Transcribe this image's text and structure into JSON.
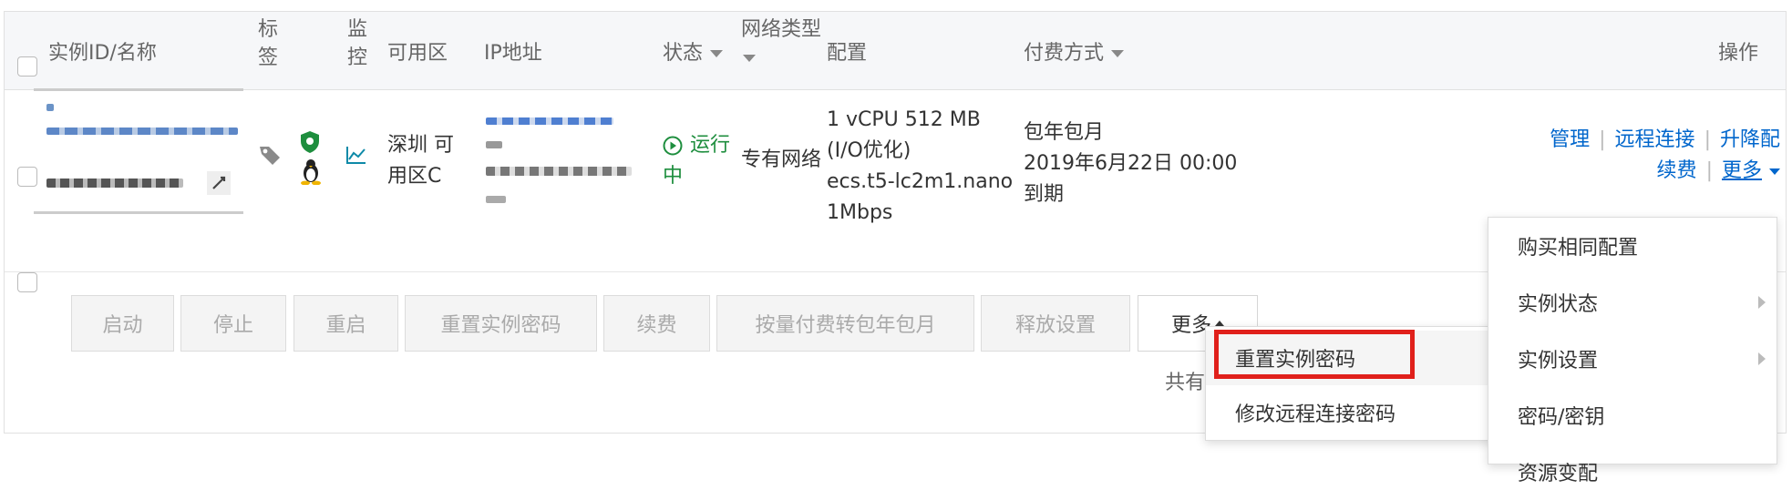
{
  "header": {
    "instance_id": "实例ID/名称",
    "tag": "标签",
    "monitor": "监控",
    "zone": "可用区",
    "ip": "IP地址",
    "status": "状态",
    "network_type": "网络类型",
    "config": "配置",
    "billing": "付费方式",
    "ops": "操作"
  },
  "row": {
    "zone": "深圳 可用区C",
    "status": "运行中",
    "network": "专有网络",
    "config_line1": "1 vCPU 512 MB (I/O优化)",
    "config_line2": "ecs.t5-lc2m1.nano",
    "config_line3": "1Mbps",
    "billing_line1": "包年包月",
    "billing_line2": "2019年6月22日 00:00",
    "billing_line3": "到期",
    "ops": {
      "manage": "管理",
      "remote": "远程连接",
      "upgrade": "升降配",
      "renew": "续费",
      "more": "更多"
    }
  },
  "toolbar": {
    "start": "启动",
    "stop": "停止",
    "restart": "重启",
    "reset_password": "重置实例密码",
    "renew": "续费",
    "convert": "按量付费转包年包月",
    "release": "释放设置",
    "more": "更多"
  },
  "total_text": "共有",
  "dropdown_more": {
    "items": [
      "重置实例密码",
      "修改远程连接密码"
    ]
  },
  "dropdown_ops": {
    "items": [
      "购买相同配置",
      "实例状态",
      "实例设置",
      "密码/密钥",
      "资源变配"
    ]
  },
  "colors": {
    "link": "#0066cc",
    "running": "#1e8e3e",
    "highlight": "#e0201b"
  }
}
